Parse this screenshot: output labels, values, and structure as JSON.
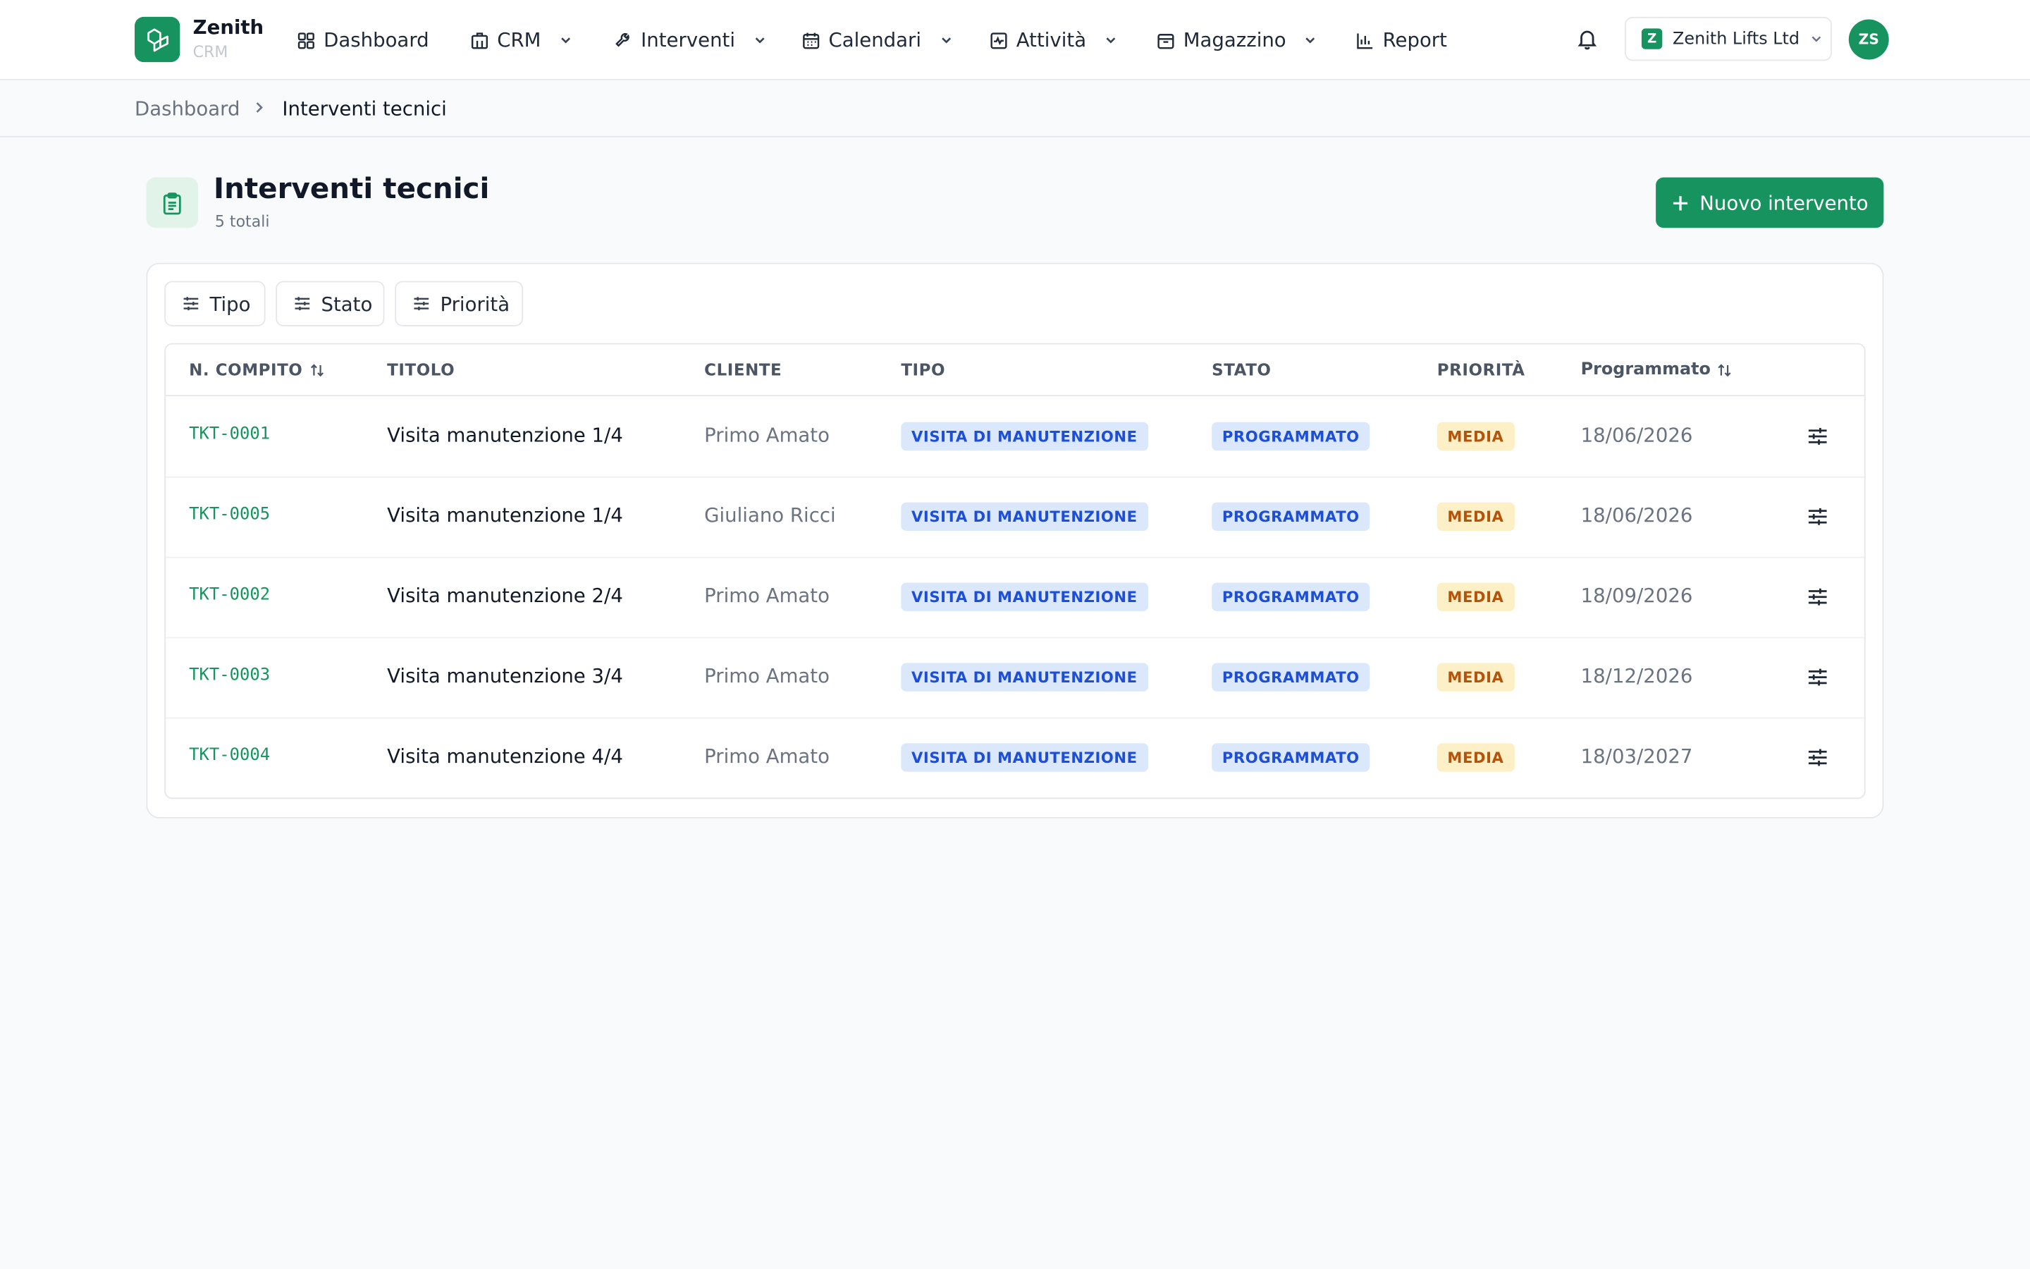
{
  "brand": {
    "name": "Zenith",
    "sub": "CRM"
  },
  "nav": {
    "dashboard": "Dashboard",
    "crm": "CRM",
    "interventi": "Interventi",
    "calendari": "Calendari",
    "attivita": "Attività",
    "magazzino": "Magazzino",
    "report": "Report"
  },
  "company": {
    "initial": "Z",
    "name": "Zenith Lifts Ltd"
  },
  "user": {
    "initials": "ZS"
  },
  "breadcrumb": {
    "root": "Dashboard",
    "current": "Interventi tecnici"
  },
  "page": {
    "title": "Interventi tecnici",
    "subtitle": "5 totali",
    "new_button": "Nuovo intervento"
  },
  "filters": {
    "tipo": "Tipo",
    "stato": "Stato",
    "priorita": "Priorità"
  },
  "table": {
    "headers": {
      "numero": "N. COMPITO",
      "titolo": "TITOLO",
      "cliente": "CLIENTE",
      "tipo": "TIPO",
      "stato": "STATO",
      "priorita": "PRIORITÀ",
      "programmato": "Programmato"
    },
    "rows": [
      {
        "id": "TKT-0001",
        "title": "Visita manutenzione 1/4",
        "client": "Primo Amato",
        "type": "VISITA DI MANUTENZIONE",
        "status": "PROGRAMMATO",
        "priority": "MEDIA",
        "date": "18/06/2026"
      },
      {
        "id": "TKT-0005",
        "title": "Visita manutenzione 1/4",
        "client": "Giuliano Ricci",
        "type": "VISITA DI MANUTENZIONE",
        "status": "PROGRAMMATO",
        "priority": "MEDIA",
        "date": "18/06/2026"
      },
      {
        "id": "TKT-0002",
        "title": "Visita manutenzione 2/4",
        "client": "Primo Amato",
        "type": "VISITA DI MANUTENZIONE",
        "status": "PROGRAMMATO",
        "priority": "MEDIA",
        "date": "18/09/2026"
      },
      {
        "id": "TKT-0003",
        "title": "Visita manutenzione 3/4",
        "client": "Primo Amato",
        "type": "VISITA DI MANUTENZIONE",
        "status": "PROGRAMMATO",
        "priority": "MEDIA",
        "date": "18/12/2026"
      },
      {
        "id": "TKT-0004",
        "title": "Visita manutenzione 4/4",
        "client": "Primo Amato",
        "type": "VISITA DI MANUTENZIONE",
        "status": "PROGRAMMATO",
        "priority": "MEDIA",
        "date": "18/03/2027"
      }
    ]
  },
  "colors": {
    "brand": "#16935f",
    "type_badge": "#dbe8fb",
    "priority_badge": "#fdf0c7"
  },
  "icons": {
    "logo": "brand-logo-icon",
    "bell": "bell-icon",
    "filter": "sliders-icon",
    "sort": "sort-icon",
    "row_action": "sliders-icon"
  }
}
